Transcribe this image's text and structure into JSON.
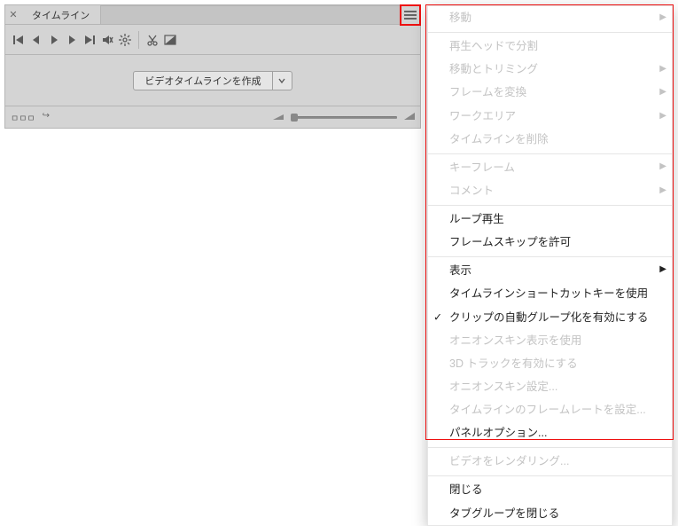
{
  "panel": {
    "tab_title": "タイムライン",
    "footer_mode_label": "ㅁㅁㅁ",
    "create_button_label": "ビデオタイムラインを作成"
  },
  "menu": {
    "items": [
      {
        "label": "移動",
        "enabled": false,
        "submenu": true
      },
      {
        "label": "再生ヘッドで分割",
        "enabled": false,
        "sep": true
      },
      {
        "label": "移動とトリミング",
        "enabled": false,
        "submenu": true
      },
      {
        "label": "フレームを変換",
        "enabled": false,
        "submenu": true
      },
      {
        "label": "ワークエリア",
        "enabled": false,
        "submenu": true
      },
      {
        "label": "タイムラインを削除",
        "enabled": false
      },
      {
        "label": "キーフレーム",
        "enabled": false,
        "submenu": true,
        "sep": true
      },
      {
        "label": "コメント",
        "enabled": false,
        "submenu": true
      },
      {
        "label": "ループ再生",
        "enabled": true,
        "sep": true
      },
      {
        "label": "フレームスキップを許可",
        "enabled": true
      },
      {
        "label": "表示",
        "enabled": true,
        "submenu": true,
        "sep": true
      },
      {
        "label": "タイムラインショートカットキーを使用",
        "enabled": true
      },
      {
        "label": "クリップの自動グループ化を有効にする",
        "enabled": true,
        "checked": true
      },
      {
        "label": "オニオンスキン表示を使用",
        "enabled": false
      },
      {
        "label": "3D トラックを有効にする",
        "enabled": false
      },
      {
        "label": "オニオンスキン設定...",
        "enabled": false
      },
      {
        "label": "タイムラインのフレームレートを設定...",
        "enabled": false
      },
      {
        "label": "パネルオプション...",
        "enabled": true
      },
      {
        "label": "ビデオをレンダリング...",
        "enabled": false,
        "sep": true
      },
      {
        "label": "閉じる",
        "enabled": true,
        "sep": true
      },
      {
        "label": "タブグループを閉じる",
        "enabled": true
      }
    ]
  }
}
